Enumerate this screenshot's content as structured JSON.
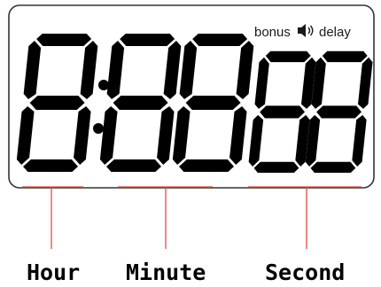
{
  "indicators": {
    "bonus": "bonus",
    "speaker_icon": "speaker-icon",
    "delay": "delay"
  },
  "labels": {
    "hour": "Hour",
    "minute": "Minute",
    "second": "Second"
  },
  "colors": {
    "segments": "#000000",
    "pointer_lines": "#e84a3a",
    "panel_border": "#333333"
  }
}
